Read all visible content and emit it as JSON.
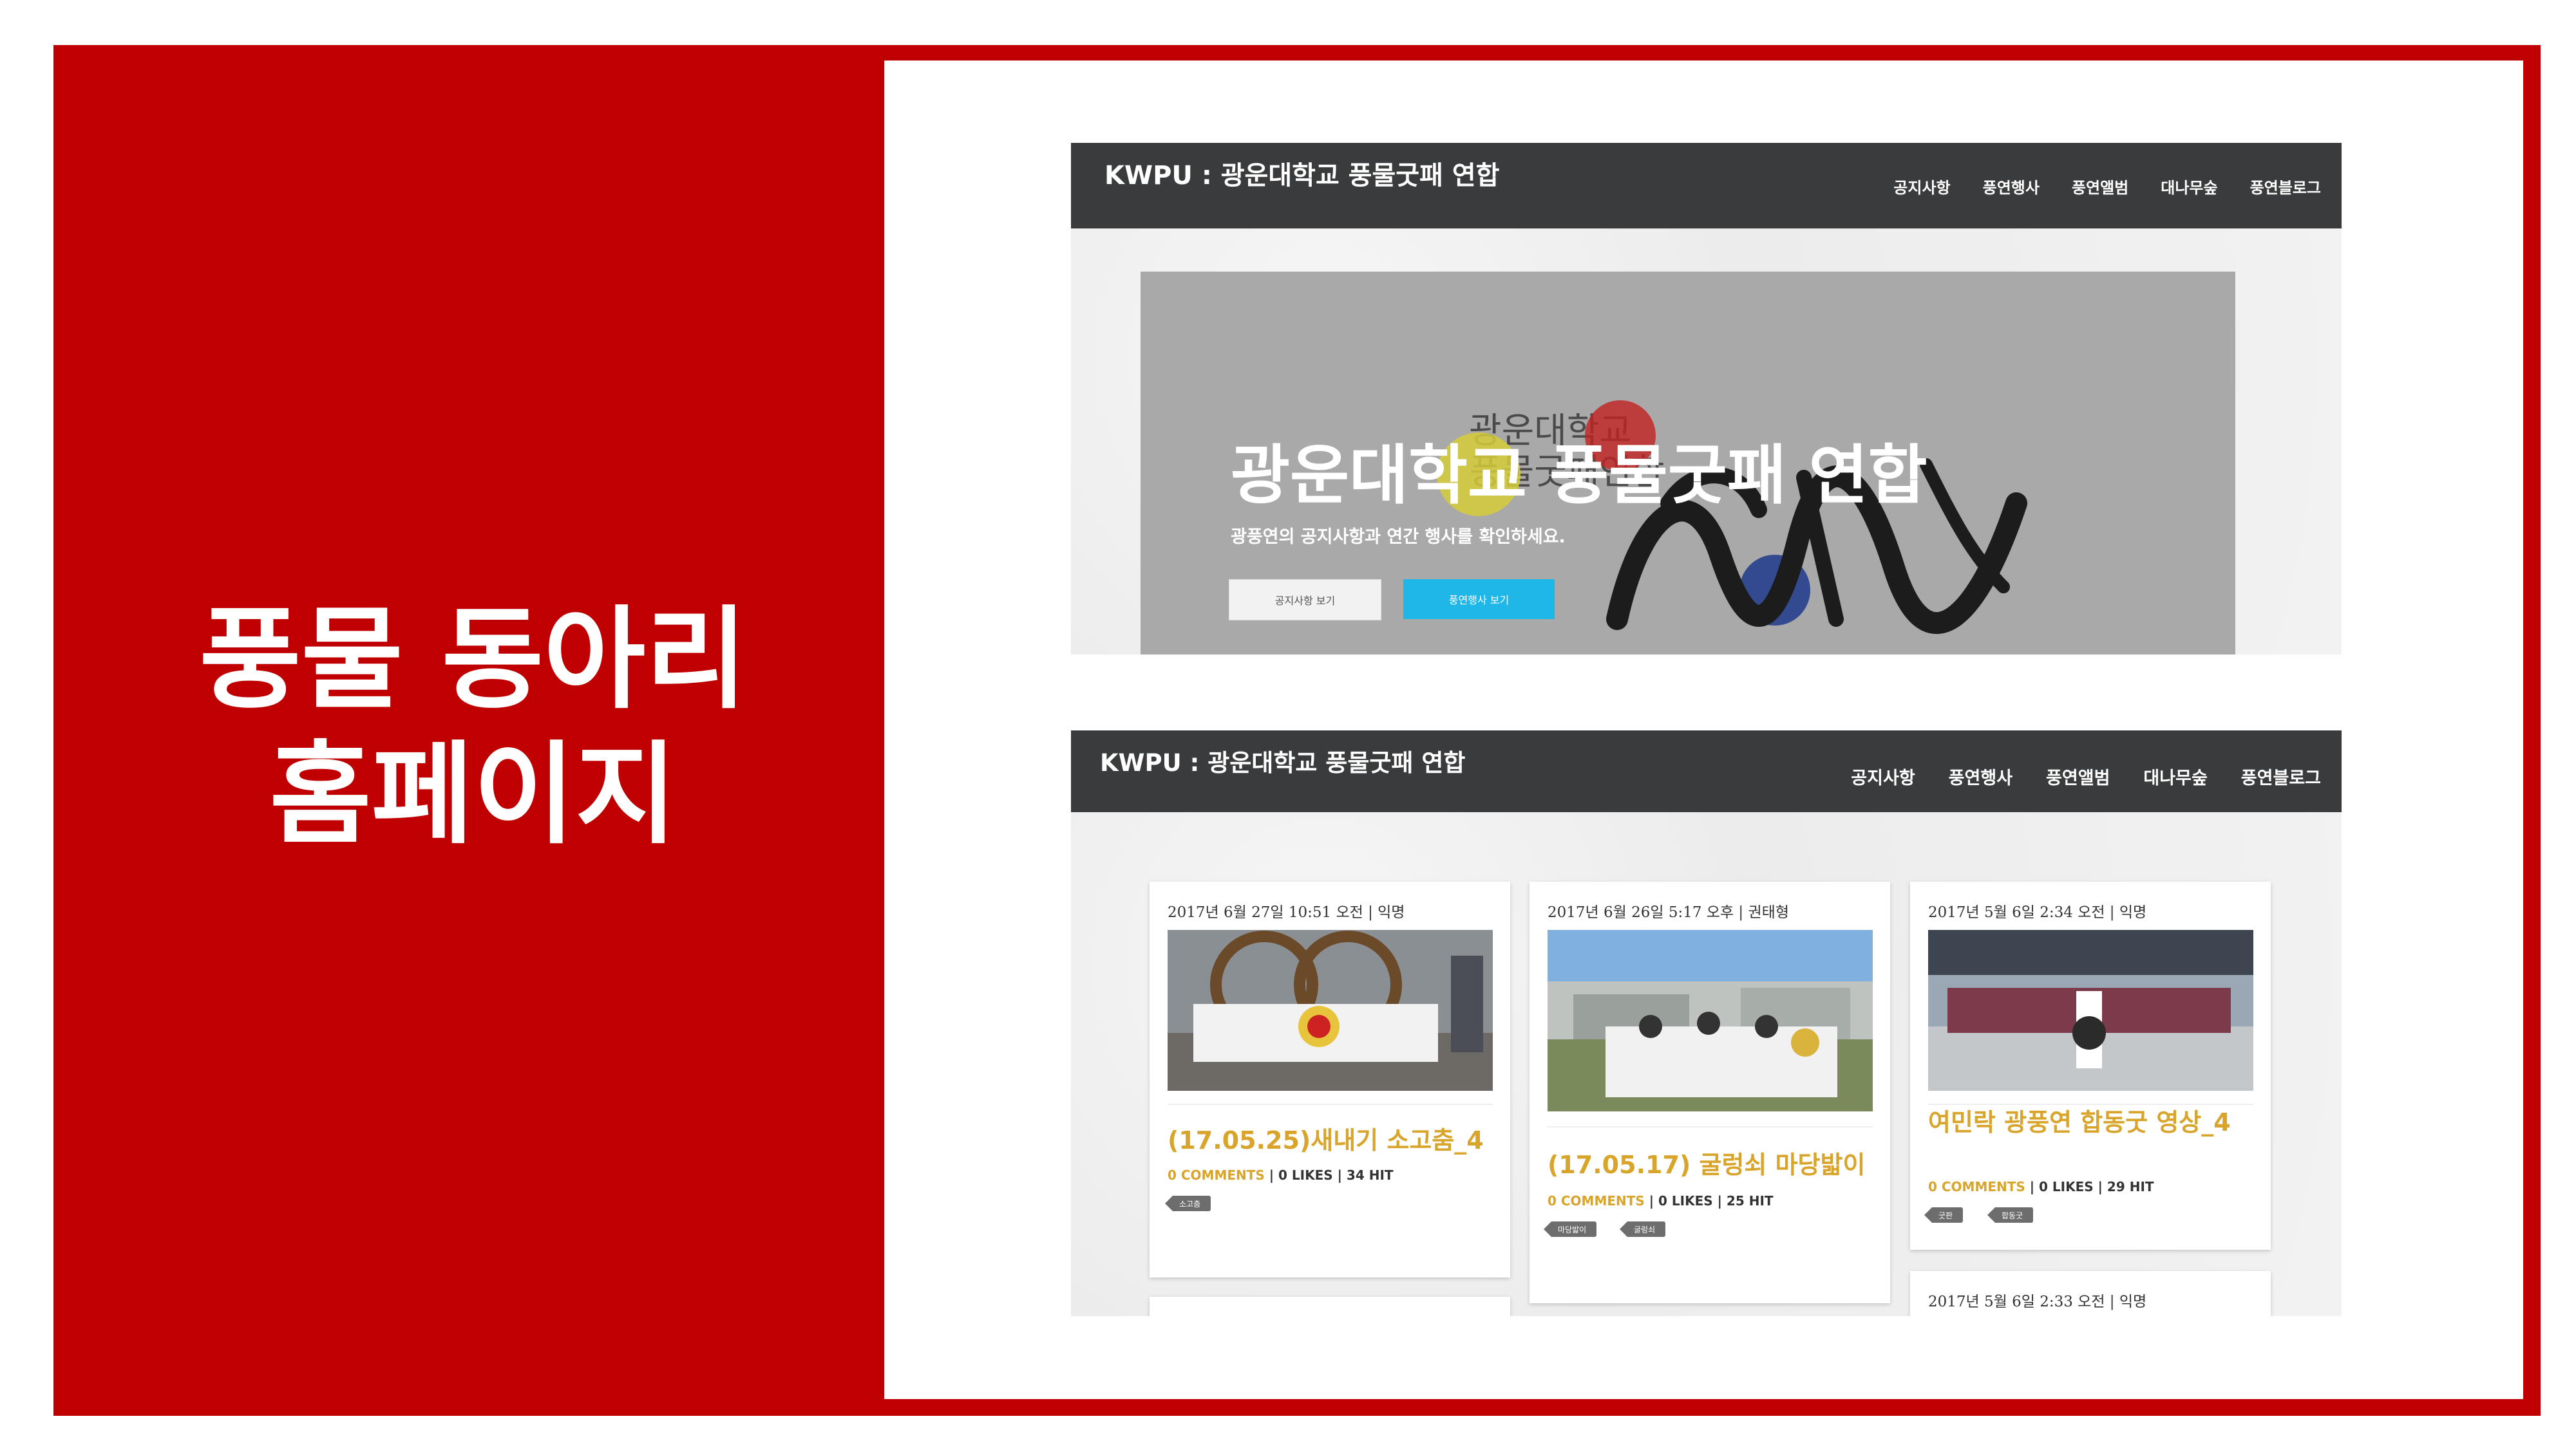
{
  "slide": {
    "title_lines": [
      "풍물 동아리",
      "홈페이지"
    ],
    "colors": {
      "frame": "#c00000",
      "panel": "#ffffff"
    }
  },
  "site": {
    "brand": "KWPU : 광운대학교 풍물굿패 연합",
    "nav": [
      "공지사항",
      "풍연행사",
      "풍연앨범",
      "대나무숲",
      "풍연블로그"
    ],
    "hero": {
      "heading": "광운대학교 풍물굿패 연합",
      "subheading": "광풍연의 공지사항과 연간 행사를 확인하세요.",
      "button_notice": "공지사항 보기",
      "button_event": "풍연행사 보기"
    },
    "logo_text": [
      "광운대학교",
      "풍물굿패연합"
    ],
    "colors": {
      "navbar": "#3a3b3c",
      "accent": "#d9a42a",
      "button_blue": "#1eb7e8"
    }
  },
  "posts": [
    {
      "meta": "2017년 6월 27일 10:51 오전 | 익명",
      "title": "(17.05.25)새내기 소고춤_4",
      "comments": "0 COMMENTS",
      "stats": "| 0 LIKES | 34 HIT",
      "tags": [
        "소고춤"
      ]
    },
    {
      "meta": "2017년 6월 26일 5:17 오후 | 권태형",
      "title": "(17.05.17) 굴렁쇠 마당밟이",
      "comments": "0 COMMENTS",
      "stats": "| 0 LIKES | 25 HIT",
      "tags": [
        "마당밟이",
        "굴렁쇠"
      ]
    },
    {
      "meta": "2017년 5월 6일 2:34 오전 | 익명",
      "title": "여민락 광풍연 합동굿 영상_4",
      "comments": "0 COMMENTS",
      "stats": "| 0 LIKES | 29 HIT",
      "tags": [
        "굿판",
        "합동굿"
      ]
    },
    {
      "meta": "2017년 5월 6일 2:33 오전 | 익명"
    }
  ]
}
